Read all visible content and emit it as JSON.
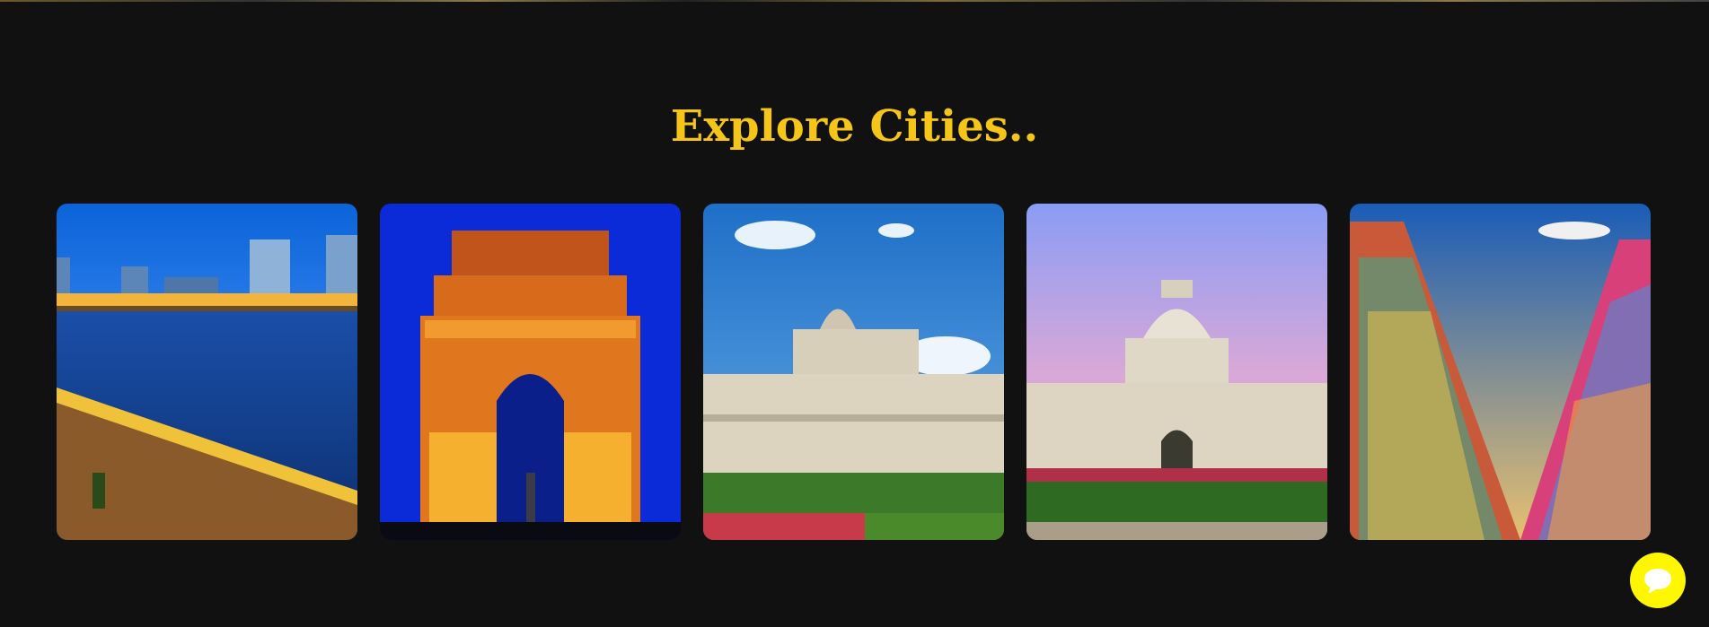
{
  "section": {
    "title": "Explore Cities.."
  },
  "cities": [
    {
      "image": "marine-drive-image"
    },
    {
      "image": "india-gate-image"
    },
    {
      "image": "vidhana-soudha-image"
    },
    {
      "image": "victoria-memorial-image"
    },
    {
      "image": "temple-gopuram-image"
    }
  ],
  "chat": {
    "icon": "chat-bubble-icon"
  },
  "colors": {
    "background": "#111111",
    "accent": "#f5c518",
    "chat_button": "#fff700"
  }
}
